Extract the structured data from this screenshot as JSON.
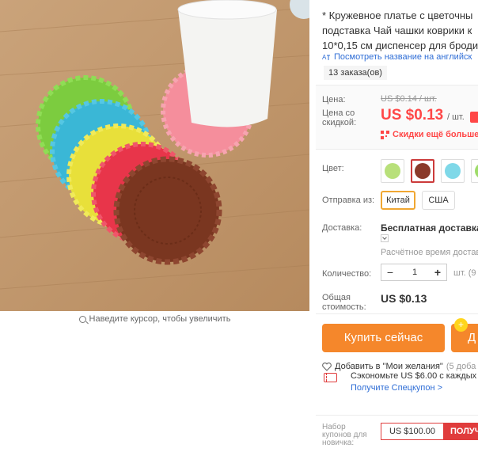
{
  "product": {
    "title_lines": [
      "* Кружевное платье с цветочны",
      "подставка Чай чашки коврики к",
      "10*0,15 см диспенсер для броди"
    ],
    "translate_link": "Посмотреть название на английск",
    "orders": "13 заказа(ов)"
  },
  "gallery": {
    "zoom_hint": "Наведите курсор, чтобы увеличить",
    "icon": "magnifier-icon",
    "coaster_colors": [
      "#7ccc3f",
      "#3ab7d6",
      "#e8e03a",
      "#e8354a",
      "#7a3620",
      "#f58e9c"
    ]
  },
  "price": {
    "label": "Цена:",
    "old_value": "US $0.14 / шт.",
    "discount_label": "Цена со скидкой:",
    "value": "US $0.13",
    "unit": "/ шт.",
    "more_discounts": "Скидки ещё больше в"
  },
  "options": {
    "color_label": "Цвет:",
    "swatches": [
      {
        "name": "lightgreen",
        "color": "#b8e07a"
      },
      {
        "name": "brown",
        "color": "#8a3a2a"
      },
      {
        "name": "lightblue",
        "color": "#7fd8e8"
      },
      {
        "name": "green",
        "color": "#9fdc6a"
      }
    ],
    "ship_from_label": "Отправка из:",
    "ship_from": [
      "Китай",
      "США"
    ],
    "ship_from_selected": "Китай"
  },
  "delivery": {
    "label": "Доставка:",
    "value": "Бесплатная доставка в",
    "estimate": "Расчётное время доставк"
  },
  "quantity": {
    "label": "Количество:",
    "value": "1",
    "minus": "−",
    "plus": "+",
    "unit": "шт. (9"
  },
  "total": {
    "label": "Общая стоимость:",
    "value": "US $0.13"
  },
  "actions": {
    "buy_now": "Купить сейчас",
    "add_to_cart": "Д",
    "cart_badge": "+",
    "wishlist": "Добавить в \"Мои желания\"",
    "wishlist_count": "(5 доба"
  },
  "coupon": {
    "save_text": "Сэкономьте US $6.00 с каждых U",
    "get_coupon": "Получите Спецкупон >",
    "newbie_label": "Набор купонов для новичка:",
    "card_value": "US $100.00",
    "card_action": "ПОЛУЧ"
  },
  "colors": {
    "accent": "#ff4747",
    "button": "#f5872b",
    "link": "#2e6dd6"
  }
}
